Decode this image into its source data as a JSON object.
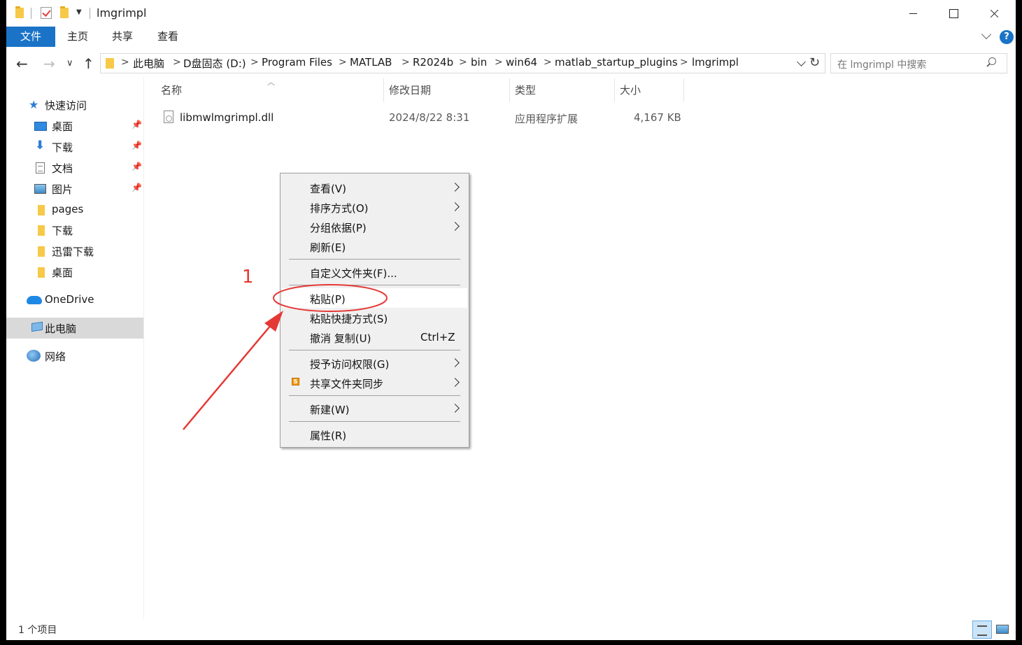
{
  "window": {
    "title": "lmgrimpl"
  },
  "ribbon": {
    "tabs": [
      "文件",
      "主页",
      "共享",
      "查看"
    ],
    "help_icon": "?"
  },
  "address": {
    "breadcrumbs": [
      "此电脑",
      "D盘固态 (D:)",
      "Program Files",
      "MATLAB",
      "R2024b",
      "bin",
      "win64",
      "matlab_startup_plugins",
      "lmgrimpl"
    ],
    "separator": ">"
  },
  "search": {
    "placeholder": "在 lmgrimpl 中搜索"
  },
  "nav": {
    "back": "←",
    "forward": "→",
    "recent": "∨",
    "up": "↑"
  },
  "sidebar": {
    "quick_access": "快速访问",
    "items": [
      {
        "label": "桌面",
        "icon": "desktop-icon",
        "pinned": true
      },
      {
        "label": "下载",
        "icon": "download-icon",
        "pinned": true
      },
      {
        "label": "文档",
        "icon": "document-icon",
        "pinned": true
      },
      {
        "label": "图片",
        "icon": "pictures-icon",
        "pinned": true
      },
      {
        "label": "pages",
        "icon": "folder-icon",
        "pinned": false
      },
      {
        "label": "下载",
        "icon": "folder-icon",
        "pinned": false
      },
      {
        "label": "迅雷下载",
        "icon": "folder-icon",
        "pinned": false
      },
      {
        "label": "桌面",
        "icon": "folder-icon",
        "pinned": false
      }
    ],
    "onedrive": "OneDrive",
    "this_pc": "此电脑",
    "network": "网络"
  },
  "filelist": {
    "columns": [
      "名称",
      "修改日期",
      "类型",
      "大小"
    ],
    "rows": [
      {
        "name": "libmwlmgrimpl.dll",
        "modified": "2024/8/22 8:31",
        "type": "应用程序扩展",
        "size": "4,167 KB"
      }
    ]
  },
  "context_menu": {
    "items": [
      {
        "label": "查看(V)",
        "submenu": true
      },
      {
        "label": "排序方式(O)",
        "submenu": true
      },
      {
        "label": "分组依据(P)",
        "submenu": true
      },
      {
        "label": "刷新(E)"
      },
      {
        "label": "自定义文件夹(F)..."
      },
      {
        "label": "粘贴(P)",
        "highlighted": true
      },
      {
        "label": "粘贴快捷方式(S)"
      },
      {
        "label": "撤消 复制(U)",
        "shortcut": "Ctrl+Z"
      },
      {
        "label": "授予访问权限(G)",
        "submenu": true
      },
      {
        "label": "共享文件夹同步",
        "submenu": true,
        "icon": "sync-icon"
      },
      {
        "label": "新建(W)",
        "submenu": true
      },
      {
        "label": "属性(R)"
      }
    ]
  },
  "status": {
    "text": "1 个项目"
  },
  "annotation": {
    "label": "1",
    "color": "#e53935"
  },
  "colors": {
    "accent": "#1a73c7",
    "selection": "#d9d9d9",
    "menu_bg": "#f0f0f0"
  }
}
